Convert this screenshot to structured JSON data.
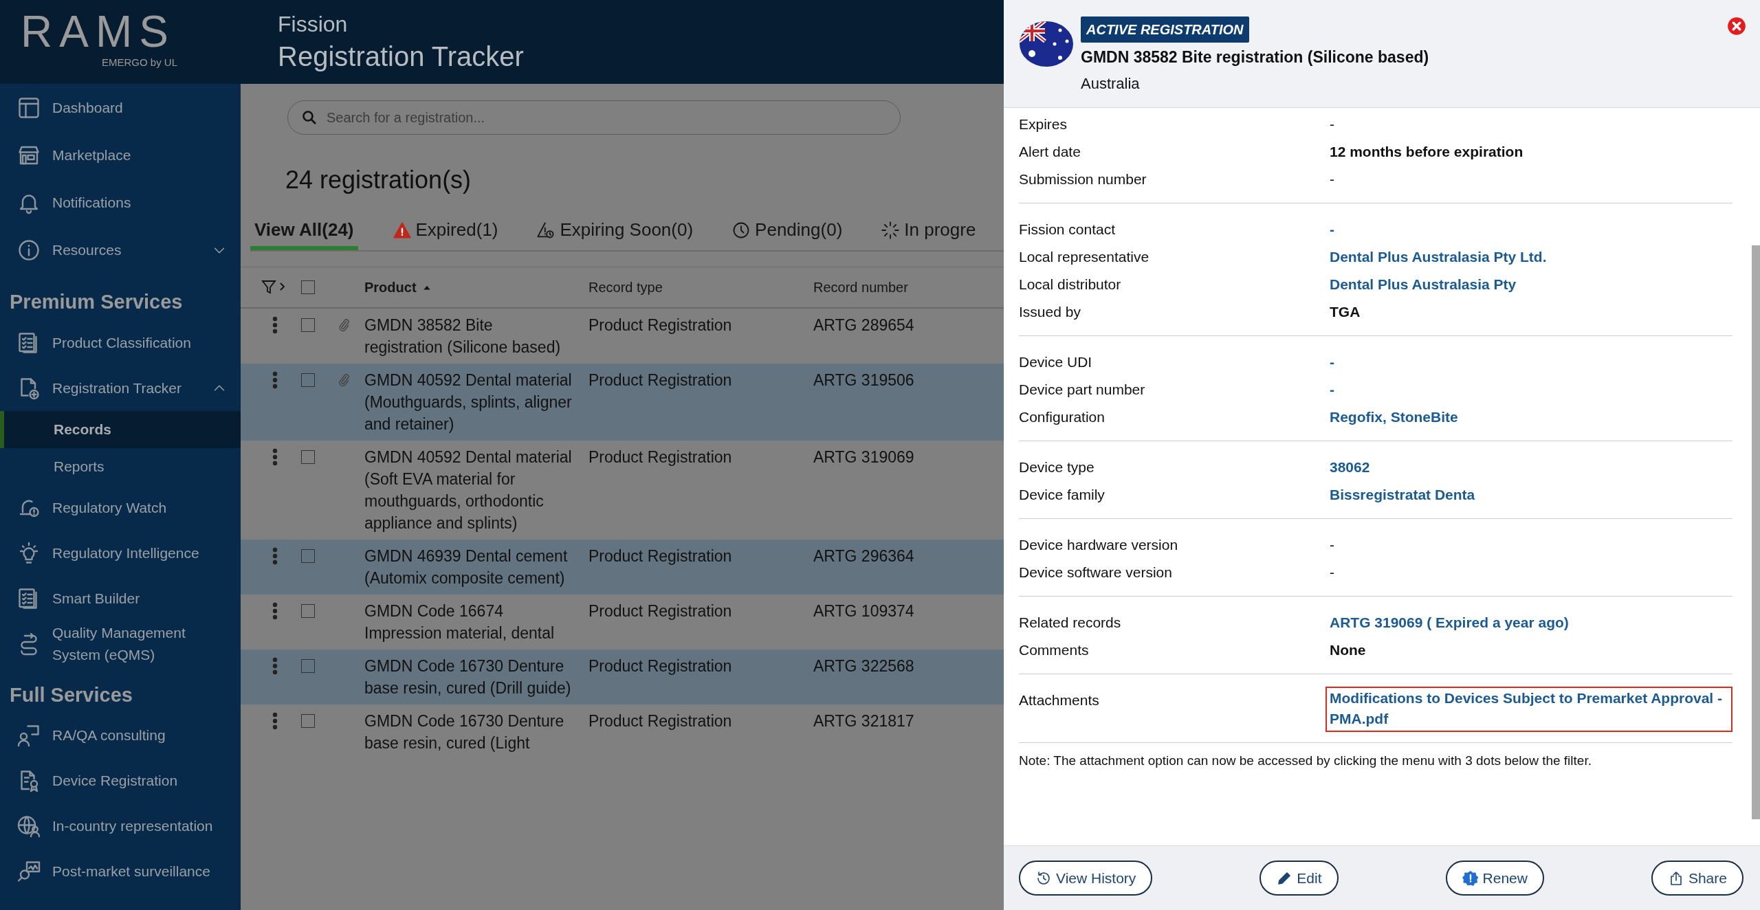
{
  "sidebar": {
    "logo": "RAMS",
    "logo_sub": "EMERGO by UL",
    "groups": [
      {
        "items": [
          {
            "label": "Dashboard"
          },
          {
            "label": "Marketplace"
          },
          {
            "label": "Notifications"
          },
          {
            "label": "Resources",
            "expanded": false
          }
        ]
      },
      {
        "heading": "Premium Services",
        "items": [
          {
            "label": "Product Classification"
          },
          {
            "label": "Registration Tracker",
            "expanded": true,
            "children": [
              {
                "label": "Records",
                "selected": true
              },
              {
                "label": "Reports",
                "selected": false
              }
            ]
          },
          {
            "label": "Regulatory Watch"
          },
          {
            "label": "Regulatory Intelligence"
          },
          {
            "label": "Smart Builder"
          },
          {
            "label": "Quality Management System (eQMS)"
          }
        ]
      },
      {
        "heading": "Full Services",
        "items": [
          {
            "label": "RA/QA consulting"
          },
          {
            "label": "Device Registration"
          },
          {
            "label": "In-country representation"
          },
          {
            "label": "Post-market surveillance"
          }
        ]
      }
    ]
  },
  "header": {
    "org": "Fission",
    "title": "Registration Tracker"
  },
  "search": {
    "placeholder": "Search for a registration..."
  },
  "count": "24 registration(s)",
  "tabs": [
    {
      "label": "View All(24)",
      "kind": "all",
      "selected": true
    },
    {
      "label": "Expired(1)",
      "kind": "expired",
      "selected": false
    },
    {
      "label": "Expiring Soon(0)",
      "kind": "expiring",
      "selected": false
    },
    {
      "label": "Pending(0)",
      "kind": "pending",
      "selected": false
    },
    {
      "label": "In progre",
      "kind": "progress",
      "selected": false
    }
  ],
  "table": {
    "header_checked": false,
    "columns": [
      {
        "label": "Product",
        "sorted": true
      },
      {
        "label": "Record type"
      },
      {
        "label": "Record number"
      }
    ],
    "rows": [
      {
        "product": "GMDN 38582 Bite registration (Silicone based)",
        "record_type": "Product Registration",
        "record_number": "ARTG 289654",
        "attachment": true,
        "checked": false
      },
      {
        "product": "GMDN 40592 Dental material (Mouthguards, splints, aligner and retainer)",
        "record_type": "Product Registration",
        "record_number": "ARTG 319506",
        "attachment": true,
        "checked": false
      },
      {
        "product": "GMDN 40592 Dental material (Soft EVA material for mouthguards, orthodontic appliance and splints)",
        "record_type": "Product Registration",
        "record_number": "ARTG 319069",
        "attachment": false,
        "checked": false
      },
      {
        "product": "GMDN 46939 Dental cement (Automix composite cement)",
        "record_type": "Product Registration",
        "record_number": "ARTG 296364",
        "attachment": false,
        "checked": false
      },
      {
        "product": "GMDN Code 16674 Impression material, dental",
        "record_type": "Product Registration",
        "record_number": "ARTG 109374",
        "attachment": false,
        "checked": false
      },
      {
        "product": "GMDN Code 16730 Denture base resin, cured (Drill guide)",
        "record_type": "Product Registration",
        "record_number": "ARTG 322568",
        "attachment": false,
        "checked": false
      },
      {
        "product": "GMDN Code 16730 Denture base resin, cured (Light",
        "record_type": "Product Registration",
        "record_number": "ARTG 321817",
        "attachment": false,
        "checked": false
      }
    ]
  },
  "panel": {
    "badge": "ACTIVE REGISTRATION",
    "title": "GMDN 38582 Bite registration (Silicone based)",
    "country": "Australia",
    "sections": [
      {
        "fields": [
          {
            "label": "Expires",
            "value": "-",
            "kind": "plain"
          },
          {
            "label": "Alert date",
            "value": "12 months before expiration",
            "kind": "bold"
          },
          {
            "label": "Submission number",
            "value": "-",
            "kind": "plain"
          }
        ]
      },
      {
        "fields": [
          {
            "label": "Fission contact",
            "value": "-",
            "kind": "link"
          },
          {
            "label": "Local representative",
            "value": "Dental Plus Australasia Pty Ltd.",
            "kind": "link"
          },
          {
            "label": "Local distributor",
            "value": "Dental Plus Australasia Pty",
            "kind": "link"
          },
          {
            "label": "Issued by",
            "value": "TGA",
            "kind": "bold"
          }
        ]
      },
      {
        "fields": [
          {
            "label": "Device UDI",
            "value": "-",
            "kind": "link"
          },
          {
            "label": "Device part number",
            "value": "-",
            "kind": "link"
          },
          {
            "label": "Configuration",
            "value": "Regofix, StoneBite",
            "kind": "link"
          }
        ]
      },
      {
        "fields": [
          {
            "label": "Device type",
            "value": "38062",
            "kind": "link"
          },
          {
            "label": "Device family",
            "value": "Bissregistratat Denta",
            "kind": "link"
          }
        ]
      },
      {
        "fields": [
          {
            "label": "Device hardware version",
            "value": "-",
            "kind": "plain"
          },
          {
            "label": "Device software version",
            "value": "-",
            "kind": "plain"
          }
        ]
      },
      {
        "fields": [
          {
            "label": "Related records",
            "value": "ARTG 319069 ( Expired a year ago)",
            "kind": "link"
          },
          {
            "label": "Comments",
            "value": "None",
            "kind": "bold"
          }
        ]
      },
      {
        "fields": [
          {
            "label": "Attachments",
            "value": "Modifications to Devices Subject to Premarket Approval - PMA.pdf",
            "kind": "link",
            "highlighted": true
          }
        ]
      }
    ],
    "note": "Note: The attachment option can now be accessed by clicking the menu with 3 dots below the filter.",
    "buttons": [
      {
        "label": "View History",
        "kind": "history"
      },
      {
        "label": "Edit",
        "kind": "edit"
      },
      {
        "label": "Renew",
        "kind": "renew"
      },
      {
        "label": "Share",
        "kind": "share"
      }
    ]
  }
}
